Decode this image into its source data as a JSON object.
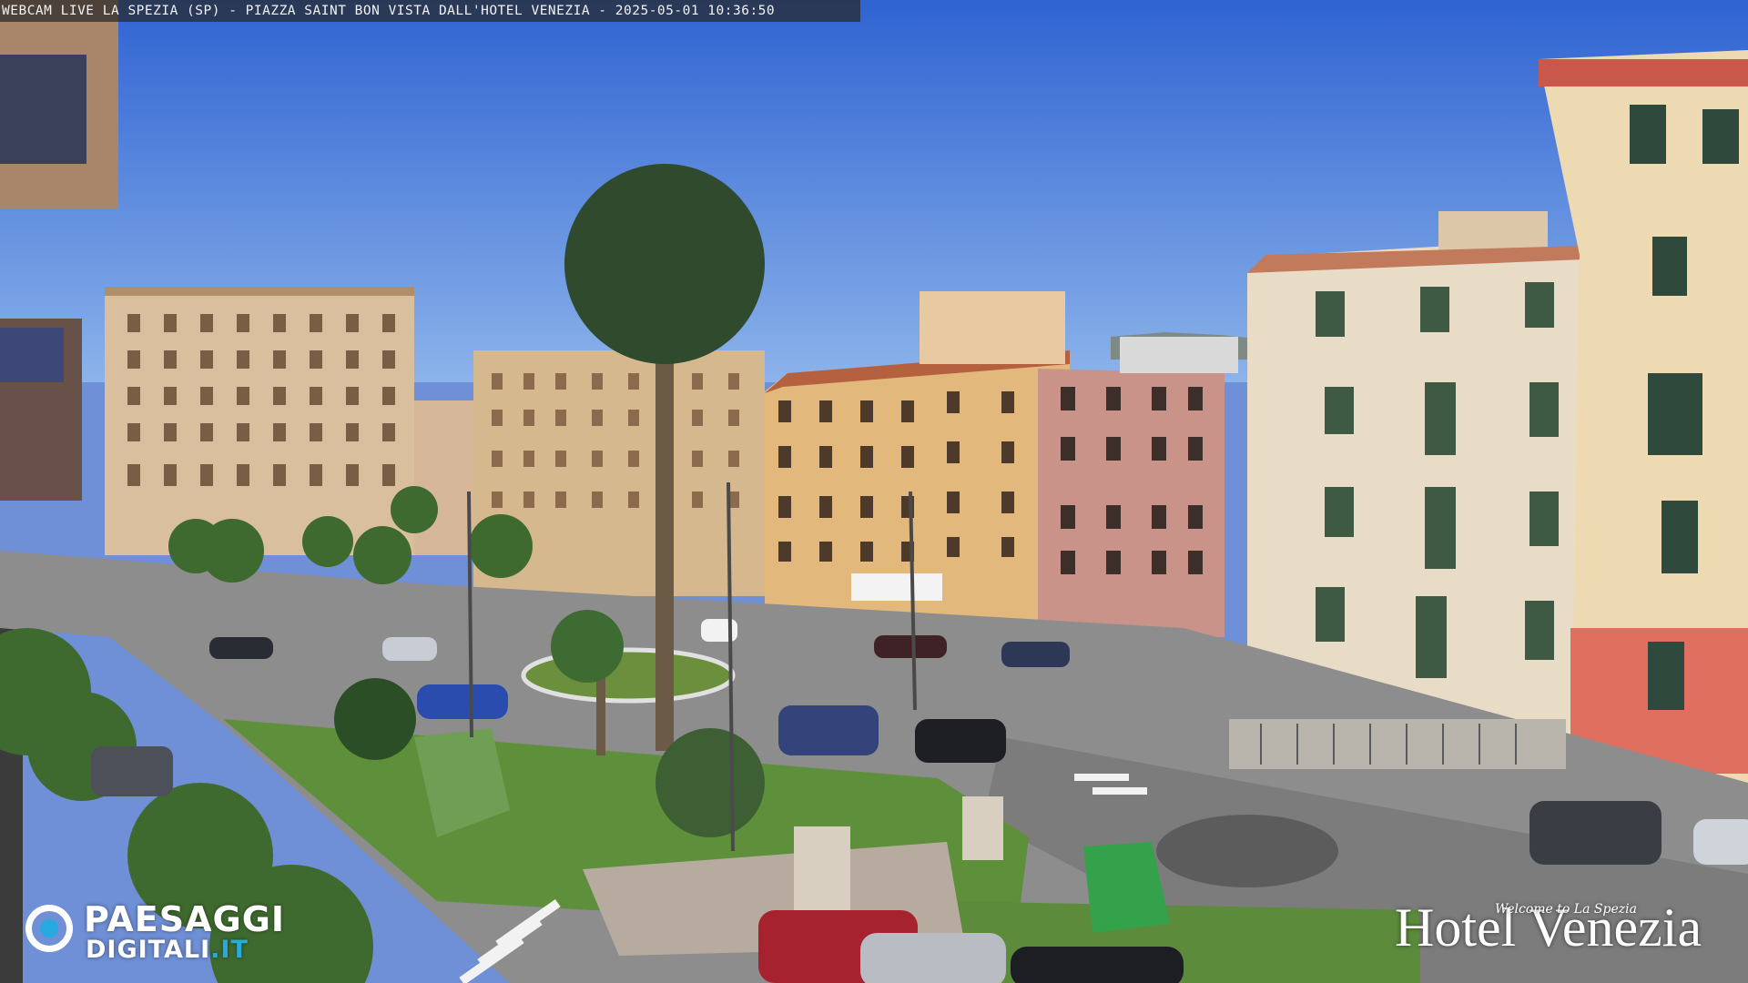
{
  "webcam": {
    "overlay_text": "WEBCAM LIVE LA SPEZIA (SP) - PIAZZA SAINT BON VISTA DALL'HOTEL VENEZIA - 2025-05-01 10:36:50"
  },
  "watermark_left": {
    "line1": "PAESAGGI",
    "line2_main": "DIGITALI",
    "line2_suffix": ".IT",
    "icon": "lens-ring-icon",
    "accent_color": "#27a9e1"
  },
  "watermark_right": {
    "tagline": "Welcome to La Spezia",
    "brand": "Hotel Venezia"
  },
  "colors": {
    "sky": "#3d6fd6",
    "grass": "#5e8f3a",
    "road": "#8a8a8a",
    "facade_yellow": "#e2b87d",
    "facade_cream": "#e9dcc4",
    "facade_pink": "#e9a58f"
  }
}
